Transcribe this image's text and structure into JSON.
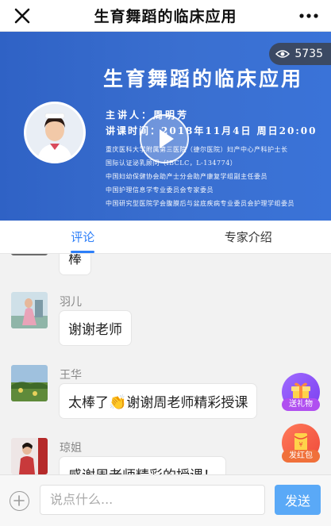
{
  "header": {
    "title": "生育舞蹈的临床应用"
  },
  "banner": {
    "title": "生育舞蹈的临床应用",
    "views": "5735",
    "speaker_line": "主讲人：周明芳",
    "time_line": "讲课时间：2018年11月4日  周日20:00",
    "bio": [
      "重庆医科大学附属第三医院（捷尔医院）妇产中心产科护士长",
      "国际认证泌乳顾问（IBCLC，L-134774）",
      "中国妇幼保健协会助产士分会助产康复学组副主任委员",
      "中国护理信息学专业委员会专家委员",
      "中国研究型医院学会腹膜后与盆底疾病专业委员会护理学组委员"
    ]
  },
  "tabs": [
    {
      "label": "评论",
      "active": true
    },
    {
      "label": "专家介绍",
      "active": false
    }
  ],
  "comments": [
    {
      "name": "",
      "text": "棒"
    },
    {
      "name": "羽儿",
      "text": "谢谢老师"
    },
    {
      "name": "王华",
      "text_before": "太棒了",
      "text_after": "谢谢周老师精彩授课"
    },
    {
      "name": "琼姐",
      "text": "感谢周老师精彩的授课！"
    }
  ],
  "fabs": {
    "gift_label": "送礼物",
    "redpacket_label": "发红包"
  },
  "input": {
    "placeholder": "说点什么...",
    "send_label": "发送"
  },
  "colors": {
    "accent": "#2d7ff9",
    "banner": "#3169cc",
    "send": "#5aa9f7",
    "gift": "#8a4ff0",
    "redpacket": "#f04f3c"
  }
}
